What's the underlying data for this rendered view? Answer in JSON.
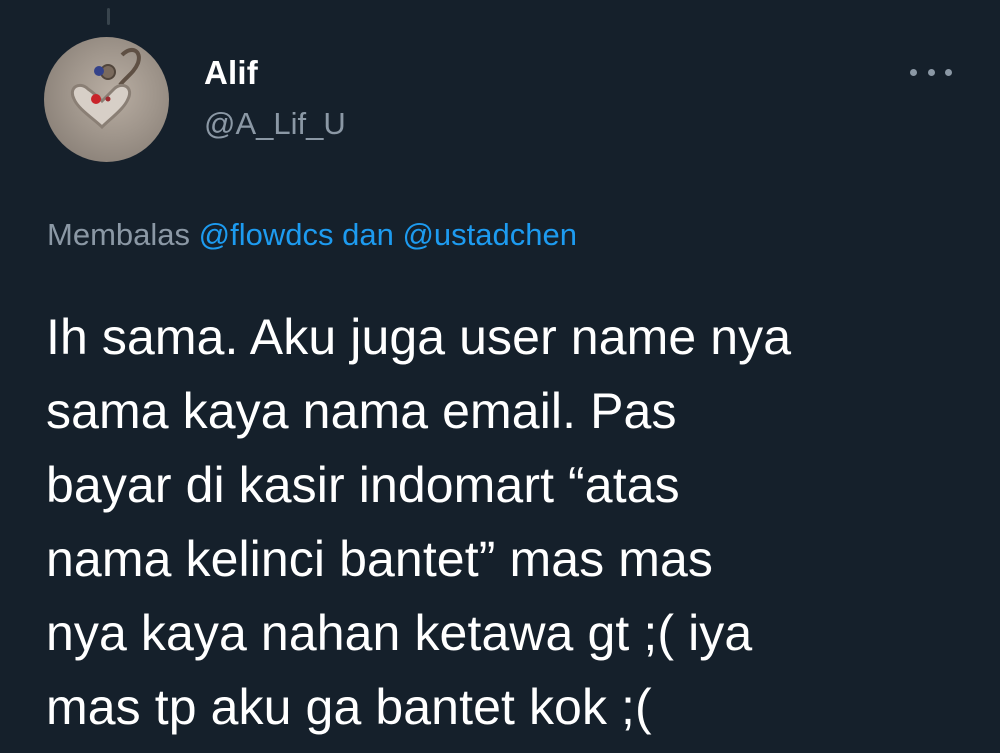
{
  "author": {
    "display_name": "Alif",
    "handle": "@A_Lif_U"
  },
  "reply": {
    "prefix": "Membalas",
    "mention_1": "@flowdcs",
    "connector": "dan",
    "mention_2": "@ustadchen"
  },
  "tweet": {
    "text": "Ih sama. Aku juga user name nya\nsama kaya nama email. Pas\nbayar di kasir indomart “atas\nnama kelinci bantet” mas mas\nnya kaya nahan ketawa gt ;( iya\nmas tp aku ga bantet kok ;("
  },
  "icons": {
    "more": "more-horizontal-icon",
    "avatar": "avatar-image"
  },
  "colors": {
    "background": "#15202b",
    "primary_text": "#ffffff",
    "secondary_text": "#8b98a5",
    "link": "#1d9bf0"
  }
}
